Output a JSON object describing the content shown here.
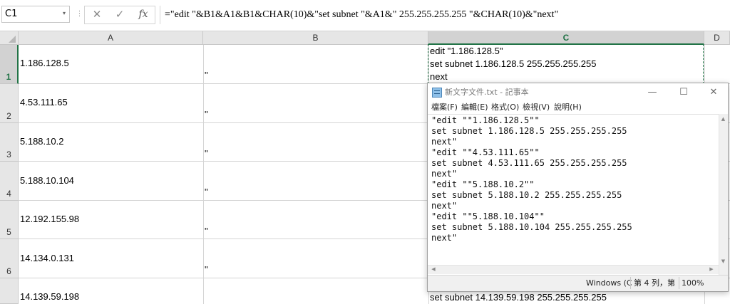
{
  "formula_bar": {
    "name_box": "C1",
    "name_box_arrow": "▾",
    "separator": "⋮",
    "cancel_icon": "✕",
    "enter_icon": "✓",
    "fx": "fx",
    "formula": "=\"edit \"&B1&A1&B1&CHAR(10)&\"set subnet \"&A1&\" 255.255.255.255 \"&CHAR(10)&\"next\""
  },
  "columns": [
    {
      "label": "A",
      "selected": false
    },
    {
      "label": "B",
      "selected": false
    },
    {
      "label": "C",
      "selected": true
    },
    {
      "label": "D",
      "selected": false
    }
  ],
  "rows": [
    {
      "header": "1",
      "a": "1.186.128.5",
      "b": "\"",
      "c": [
        "edit \"1.186.128.5\"",
        "set subnet 1.186.128.5 255.255.255.255",
        "next"
      ]
    },
    {
      "header": "2",
      "a": "4.53.111.65",
      "b": "\"",
      "c": []
    },
    {
      "header": "3",
      "a": "5.188.10.2",
      "b": "\"",
      "c": []
    },
    {
      "header": "4",
      "a": "5.188.10.104",
      "b": "\"",
      "c": []
    },
    {
      "header": "5",
      "a": "12.192.155.98",
      "b": "\"",
      "c": []
    },
    {
      "header": "6",
      "a": "14.134.0.131",
      "b": "\"",
      "c": []
    },
    {
      "header": "",
      "a": "14.139.59.198",
      "b": "",
      "c": [
        "set subnet 14.139.59.198 255.255.255.255"
      ]
    }
  ],
  "notepad": {
    "title": "新文字文件.txt - 記事本",
    "icon": "notepad-icon",
    "minimize": "—",
    "maximize": "☐",
    "close": "✕",
    "menu": [
      "檔案(F)",
      "編輯(E)",
      "格式(O)",
      "檢視(V)",
      "說明(H)"
    ],
    "lines": [
      "\"edit \"\"1.186.128.5\"\"",
      "set subnet 1.186.128.5 255.255.255.255",
      "next\"",
      "\"edit \"\"4.53.111.65\"\"",
      "set subnet 4.53.111.65 255.255.255.255",
      "next\"",
      "\"edit \"\"5.188.10.2\"\"",
      "set subnet 5.188.10.2 255.255.255.255",
      "next\"",
      "\"edit \"\"5.188.10.104\"\"",
      "set subnet 5.188.10.104 255.255.255.255",
      "next\""
    ],
    "status": {
      "encoding": "Windows (C",
      "position": "第 4 列，第",
      "zoom": "100%"
    },
    "scroll_up": "▲",
    "scroll_down": "▼",
    "scroll_left": "◀",
    "scroll_right": "▶"
  },
  "colors": {
    "excel_green": "#217346",
    "header_bg": "#e6e6e6",
    "grid_line": "#d4d4d4"
  }
}
